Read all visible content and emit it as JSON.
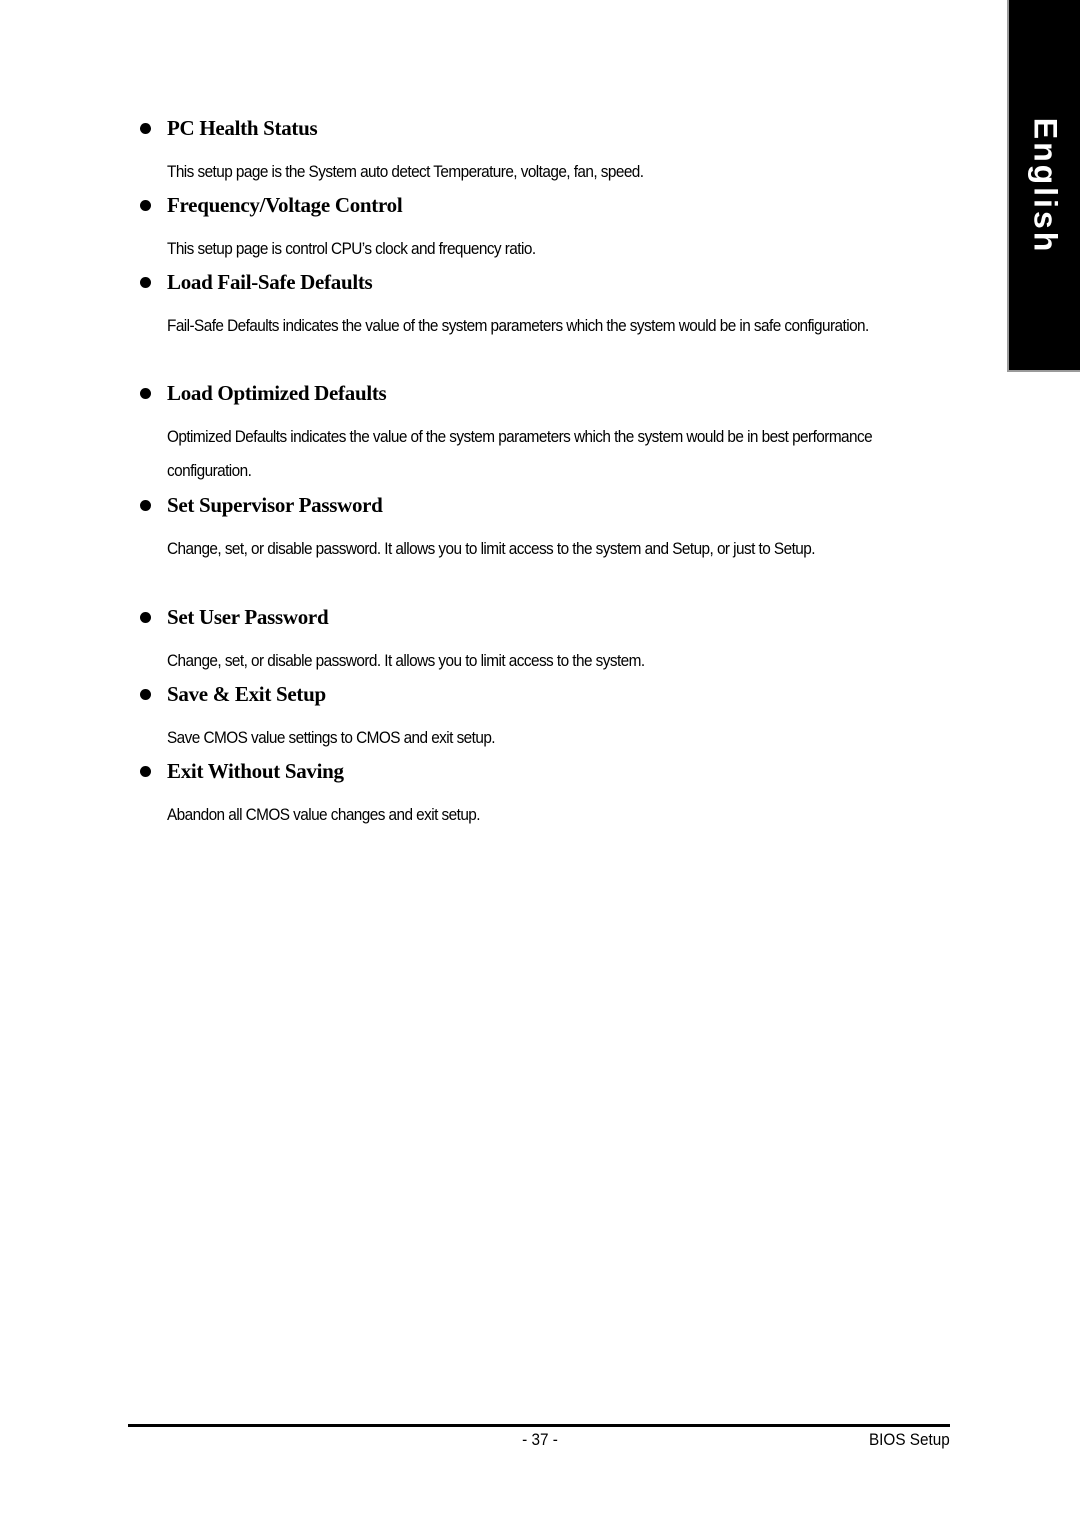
{
  "side_tab": {
    "label": "English"
  },
  "sections": [
    {
      "title": "PC Health Status",
      "description": "This setup page is the System auto detect Temperature, voltage, fan, speed."
    },
    {
      "title": "Frequency/Voltage Control",
      "description": "This setup page is control CPU’s clock and frequency ratio."
    },
    {
      "title": "Load Fail-Safe Defaults",
      "description": "Fail-Safe Defaults indicates the value of the system parameters which the system would be in safe configuration."
    },
    {
      "title": "Load Optimized Defaults",
      "description": "Optimized Defaults indicates the value of the system parameters which the system would be in best performance configuration."
    },
    {
      "title": "Set Supervisor Password",
      "description": "Change, set, or disable password. It allows you to limit access to the system and Setup, or just to Setup."
    },
    {
      "title": "Set User Password",
      "description": "Change, set, or disable password. It allows you to limit access to the system."
    },
    {
      "title": "Save & Exit Setup",
      "description": "Save CMOS value settings to CMOS and exit setup."
    },
    {
      "title": "Exit Without Saving",
      "description": "Abandon all CMOS value changes and exit setup."
    }
  ],
  "footer": {
    "page_number": "- 37 -",
    "section_title": "BIOS Setup"
  }
}
